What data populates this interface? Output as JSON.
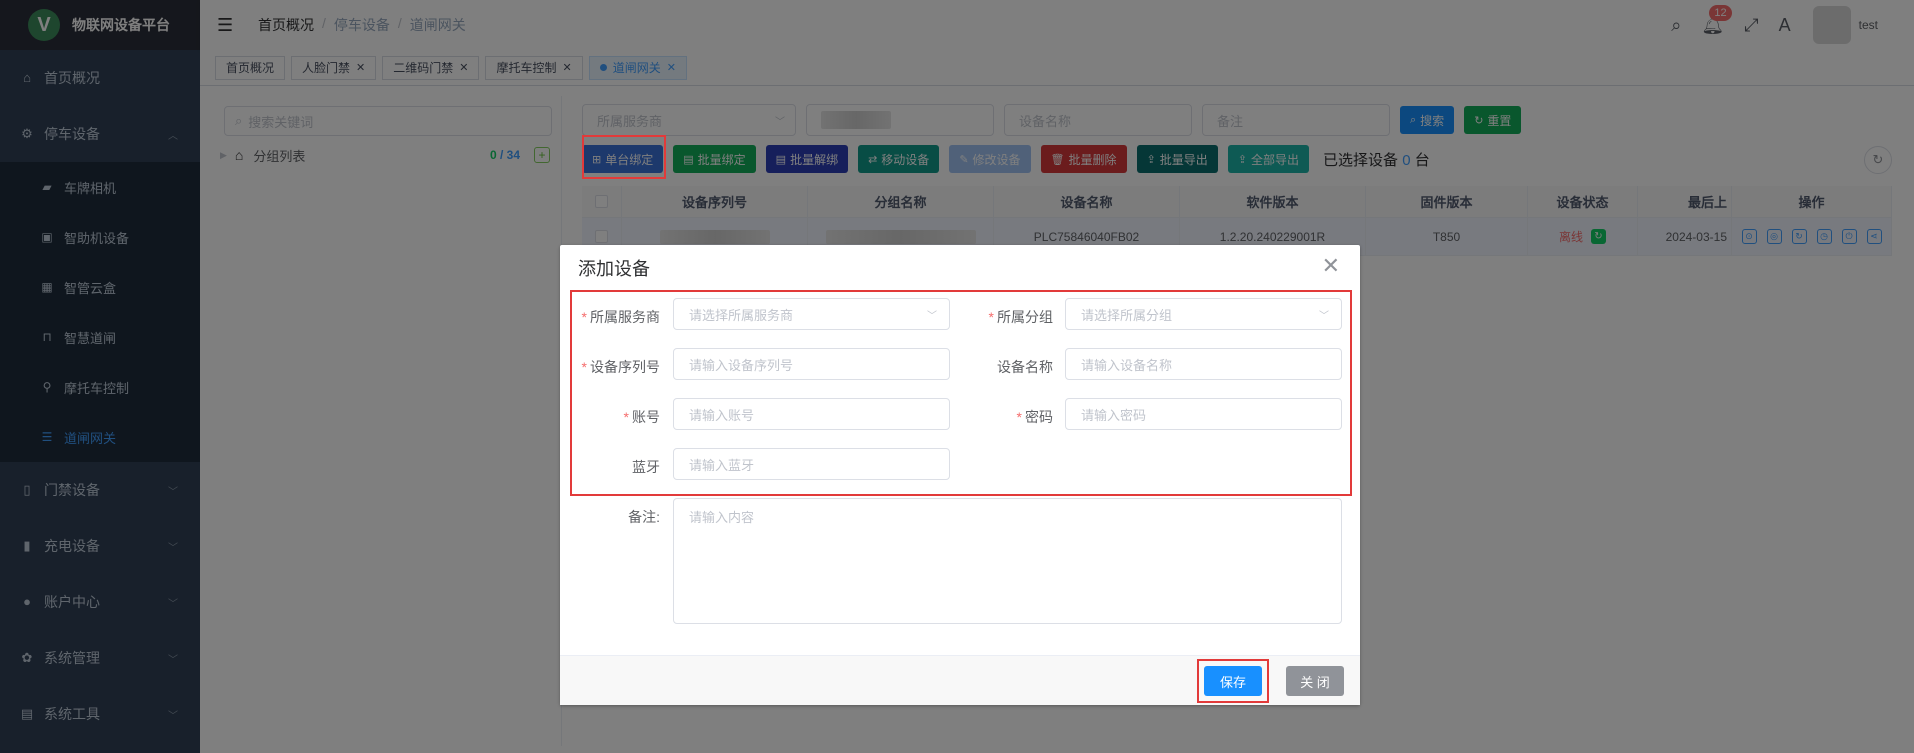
{
  "app": {
    "title": "物联网设备平台",
    "logo_letter": "V"
  },
  "sidebar": {
    "items": [
      {
        "label": "首页概况",
        "icon": "home-icon"
      },
      {
        "label": "停车设备",
        "icon": "parking-icon",
        "expanded": true,
        "children": [
          {
            "label": "车牌相机",
            "icon": "camera-icon"
          },
          {
            "label": "智助机设备",
            "icon": "kiosk-icon"
          },
          {
            "label": "智管云盒",
            "icon": "cloud-box-icon"
          },
          {
            "label": "智慧道闸",
            "icon": "barrier-gate-icon"
          },
          {
            "label": "摩托车控制",
            "icon": "motorcycle-icon"
          },
          {
            "label": "道闸网关",
            "icon": "gateway-icon",
            "active": true
          }
        ]
      },
      {
        "label": "门禁设备",
        "icon": "door-icon"
      },
      {
        "label": "充电设备",
        "icon": "charging-icon"
      },
      {
        "label": "账户中心",
        "icon": "user-icon"
      },
      {
        "label": "系统管理",
        "icon": "gear-icon"
      },
      {
        "label": "系统工具",
        "icon": "tools-icon"
      }
    ]
  },
  "header": {
    "breadcrumb": [
      "首页概况",
      "停车设备",
      "道闸网关"
    ],
    "notification_count": "12",
    "username": "test"
  },
  "tags": [
    {
      "label": "首页概况",
      "closable": false
    },
    {
      "label": "人脸门禁",
      "closable": true
    },
    {
      "label": "二维码门禁",
      "closable": true
    },
    {
      "label": "摩托车控制",
      "closable": true
    },
    {
      "label": "道闸网关",
      "closable": true,
      "active": true
    }
  ],
  "tree": {
    "search_placeholder": "搜索关键词",
    "root_label": "分组列表",
    "count_online": "0",
    "count_sep": " / ",
    "count_total": "34",
    "add_symbol": "+"
  },
  "filters": {
    "provider_placeholder": "所属服务商",
    "device_name_placeholder": "设备名称",
    "remark_placeholder": "备注",
    "search_label": "搜索",
    "reset_label": "重置"
  },
  "actions": {
    "single_bind": "单台绑定",
    "batch_bind": "批量绑定",
    "batch_unbind": "批量解绑",
    "move_device": "移动设备",
    "edit_device": "修改设备",
    "batch_delete": "批量删除",
    "batch_export": "批量导出",
    "export_all": "全部导出",
    "selected_prefix": "已选择设备",
    "selected_count": "0",
    "selected_suffix": "台"
  },
  "table": {
    "columns": [
      "设备序列号",
      "分组名称",
      "设备名称",
      "软件版本",
      "固件版本",
      "设备状态",
      "最后上",
      "操作"
    ],
    "rows": [
      {
        "serial": "",
        "group": "",
        "device_name": "PLC75846040FB02",
        "software": "1.2.20.240229001R",
        "firmware": "T850",
        "status": "离线",
        "last": "2024-03-15"
      }
    ]
  },
  "dialog": {
    "title": "添加设备",
    "fields": {
      "provider": {
        "label": "所属服务商",
        "placeholder": "请选择所属服务商",
        "required": true
      },
      "group": {
        "label": "所属分组",
        "placeholder": "请选择所属分组",
        "required": true
      },
      "serial": {
        "label": "设备序列号",
        "placeholder": "请输入设备序列号",
        "required": true
      },
      "name": {
        "label": "设备名称",
        "placeholder": "请输入设备名称",
        "required": false
      },
      "account": {
        "label": "账号",
        "placeholder": "请输入账号",
        "required": true
      },
      "password": {
        "label": "密码",
        "placeholder": "请输入密码",
        "required": true
      },
      "bluetooth": {
        "label": "蓝牙",
        "placeholder": "请输入蓝牙",
        "required": false
      },
      "remark": {
        "label": "备注:",
        "placeholder": "请输入内容",
        "required": false
      }
    },
    "required_mark": "*",
    "save_label": "保存",
    "close_label": "关 闭"
  },
  "colors": {
    "accent": "#409eff",
    "highlight": "#e23a3a",
    "sidebar_bg": "#304156"
  }
}
